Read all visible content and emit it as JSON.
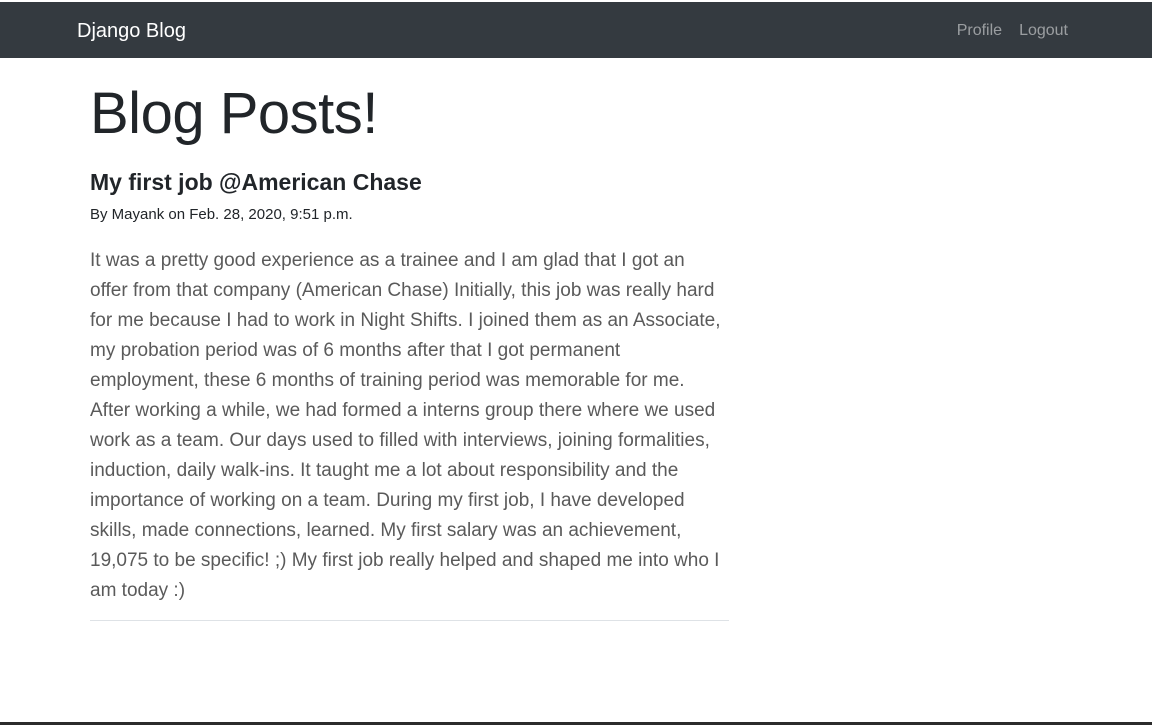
{
  "navbar": {
    "brand": "Django Blog",
    "links": [
      "Profile",
      "Logout"
    ]
  },
  "main": {
    "heading": "Blog Posts!",
    "posts": [
      {
        "title": "My first job @American Chase",
        "author": "Mayank",
        "date": "Feb. 28, 2020, 9:51 p.m.",
        "meta": "By Mayank on Feb. 28, 2020, 9:51 p.m.",
        "body": "It was a pretty good experience as a trainee and I am glad that I got an offer from that company (American Chase) Initially, this job was really hard for me because I had to work in Night Shifts. I joined them as an Associate, my probation period was of 6 months after that I got permanent employment, these 6 months of training period was memorable for me. After working a while, we had formed a interns group there where we used work as a team. Our days used to filled with interviews, joining formalities, induction, daily walk-ins. It taught me a lot about responsibility and the importance of working on a team. During my first job, I have developed skills, made connections, learned. My first salary was an achievement, 19,075 to be specific! ;) My first job really helped and shaped me into who I am today :)"
      }
    ]
  },
  "colors": {
    "navbar_bg": "#343a40",
    "brand_text": "#ffffff",
    "nav_link": "rgba(255,255,255,0.5)",
    "body_text": "#5a5a5a",
    "divider": "#dee2e6"
  }
}
